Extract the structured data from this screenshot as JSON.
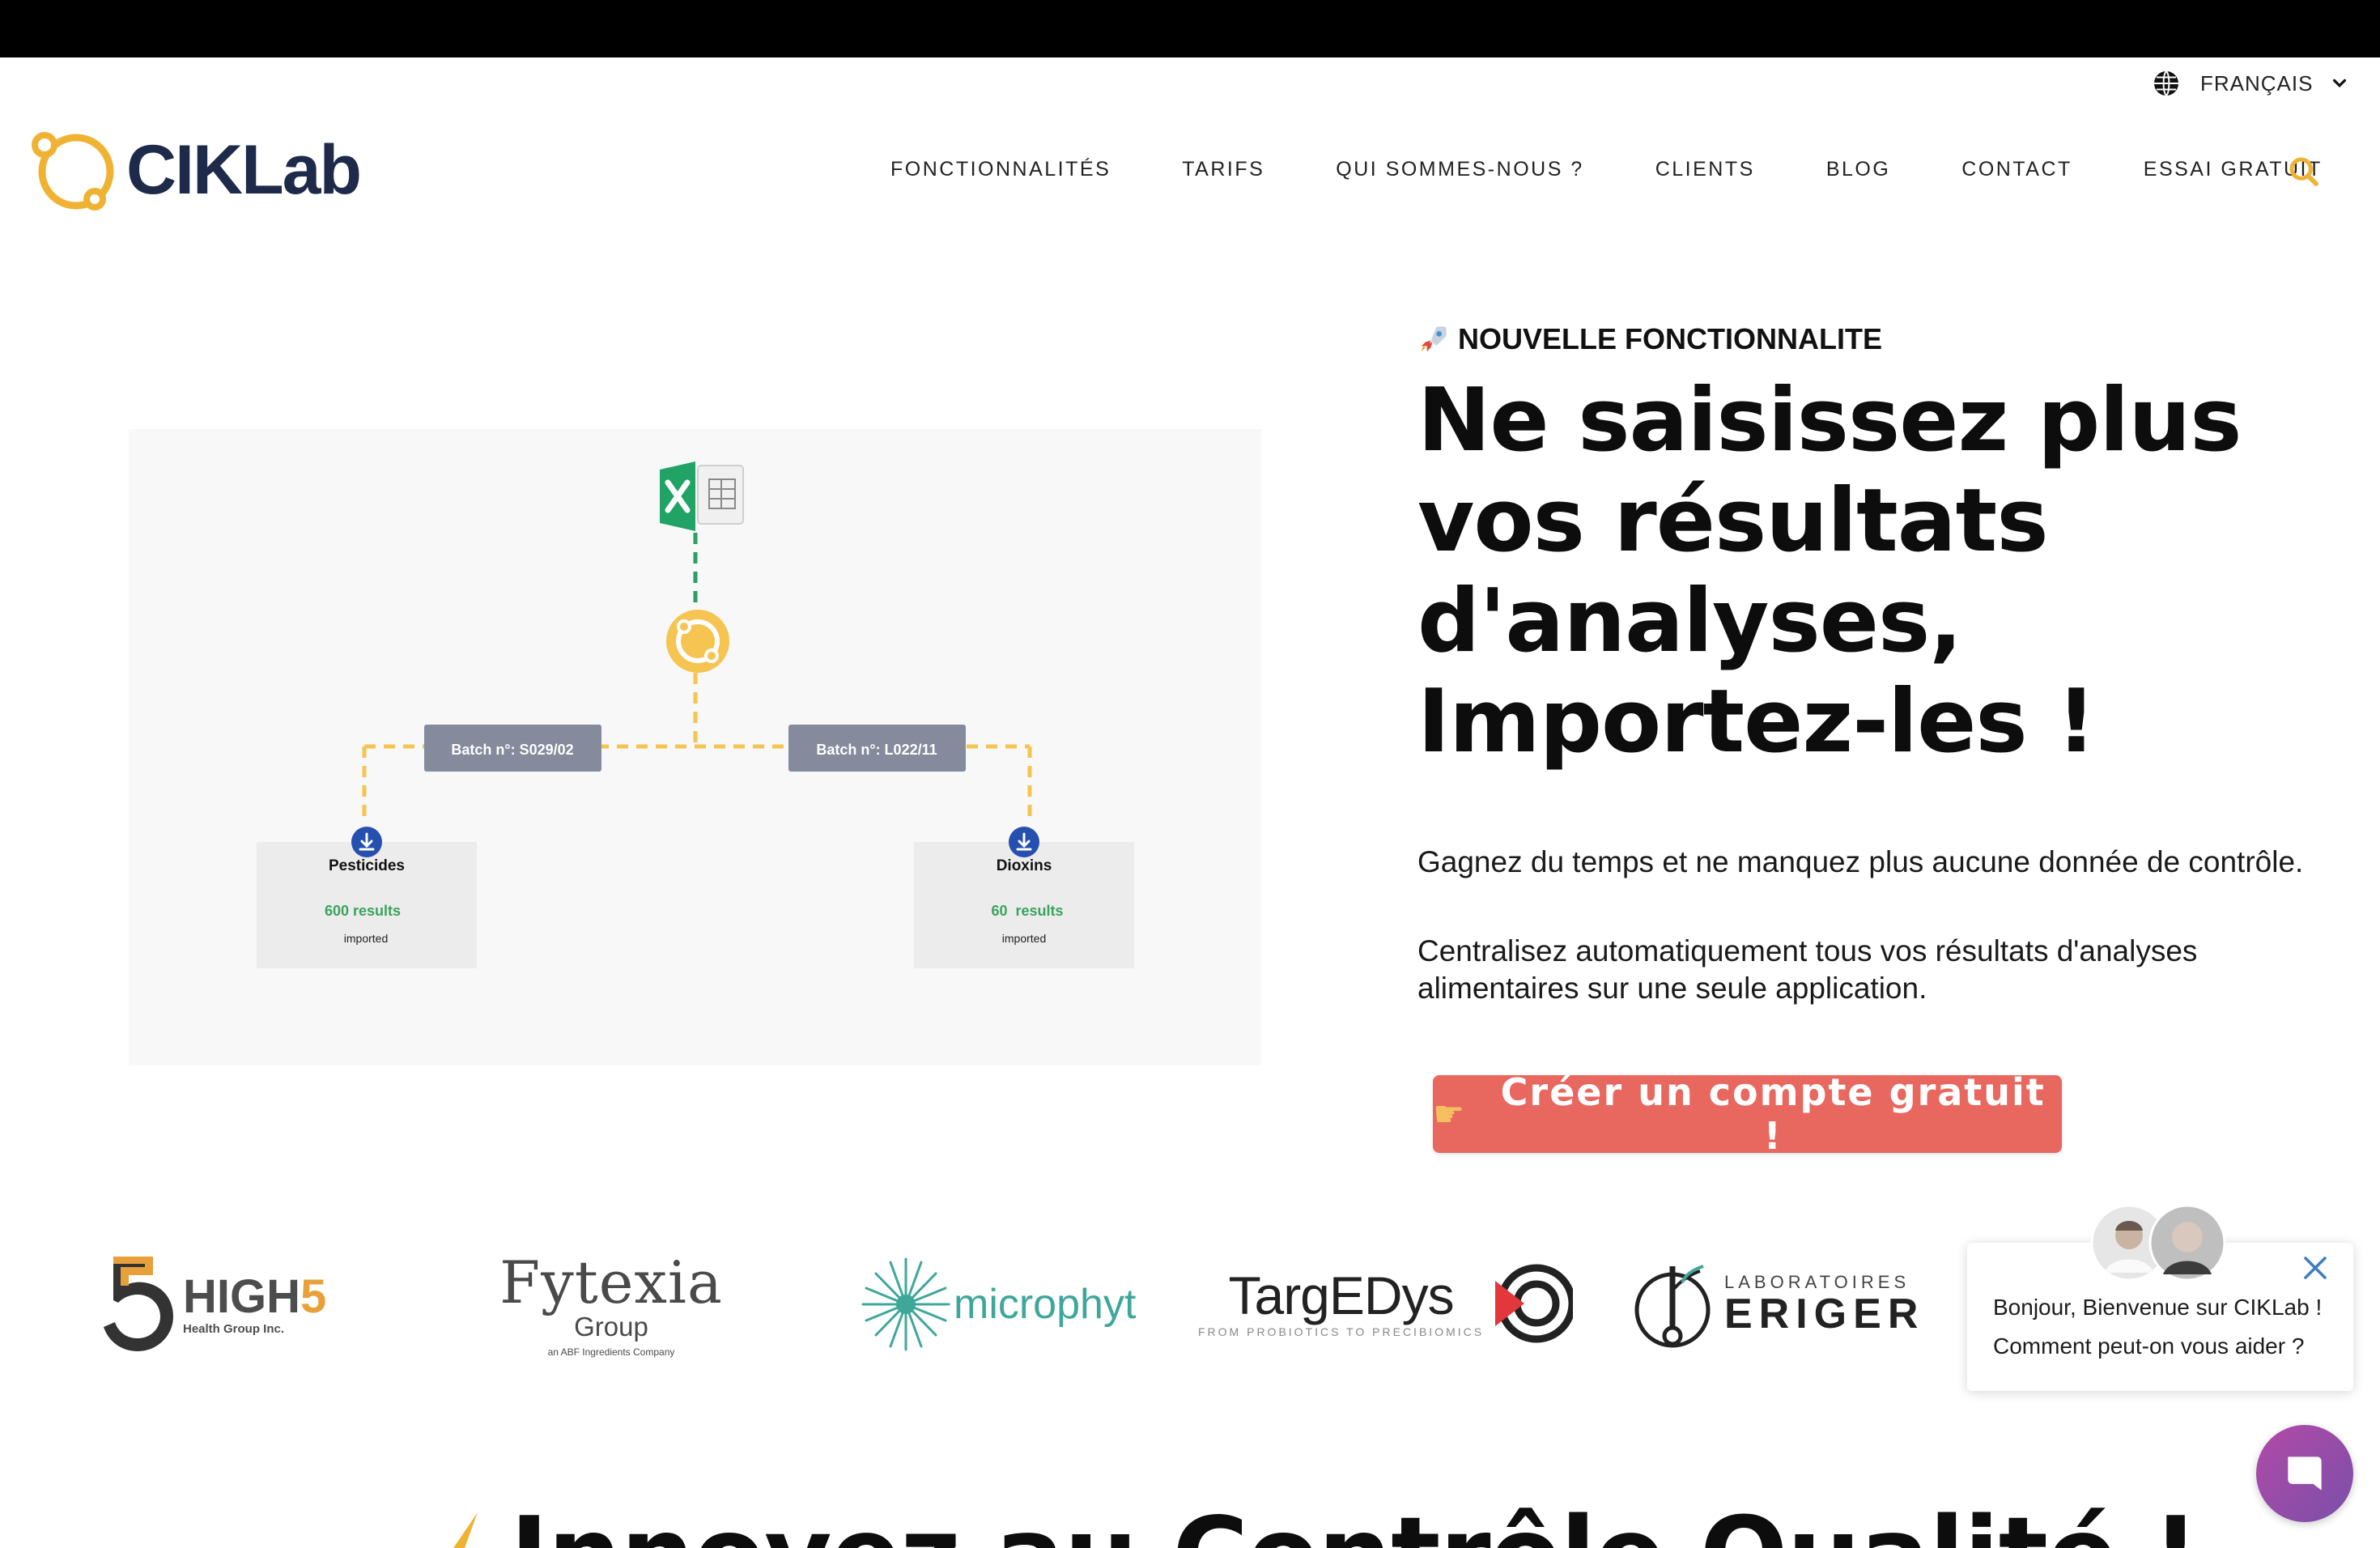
{
  "language": {
    "label": "FRANÇAIS"
  },
  "brand": {
    "name": "CIKLab",
    "accent": "#f0b233",
    "dark": "#1e2a4a"
  },
  "nav": {
    "items": [
      "FONCTIONNALITÉS",
      "TARIFS",
      "QUI SOMMES-NOUS ?",
      "CLIENTS",
      "BLOG",
      "CONTACT",
      "ESSAI GRATUIT"
    ]
  },
  "illustration": {
    "batch_left": "Batch n°: S029/02",
    "batch_right": "Batch n°: L022/11",
    "card_left": {
      "title": "Pesticides",
      "results": "600 results",
      "status": "imported"
    },
    "card_right": {
      "title": "Dioxins",
      "results": "60  results",
      "status": "imported"
    }
  },
  "hero": {
    "kicker_icon": "rocket-icon",
    "kicker": "NOUVELLE FONCTIONNALITE",
    "title_lines": [
      "Ne saisissez plus",
      "vos résultats",
      "d'analyses,",
      "Importez-les !"
    ],
    "p1": "Gagnez du temps et ne manquez plus aucune donnée de contrôle.",
    "p2": "Centralisez automatiquement tous vos résultats d'analyses alimentaires sur une seule application.",
    "cta_icon": "pointing-hand-icon",
    "cta": "Créer un compte gratuit  !",
    "cta_color": "#e8675f"
  },
  "clients": {
    "high5": {
      "name_a": "HIGH",
      "name_b": "5",
      "sub": "Health Group Inc."
    },
    "fytexia": {
      "name": "Fytexia",
      "group": "Group",
      "sub": "an ABF Ingredients Company"
    },
    "microphyt": {
      "name": "microphyt"
    },
    "targedys": {
      "name": "TargEDys",
      "sub": "FROM PROBIOTICS TO PRECIBIOMICS"
    },
    "eriger": {
      "line1": "LABORATOIRES",
      "line2": "ERIGER"
    }
  },
  "chat": {
    "message_line1": "Bonjour, Bienvenue sur CIKLab !",
    "message_line2": "Comment peut-on vous aider ?"
  },
  "bottom": {
    "heading": "Innovez au Contrôle Qualité !"
  }
}
